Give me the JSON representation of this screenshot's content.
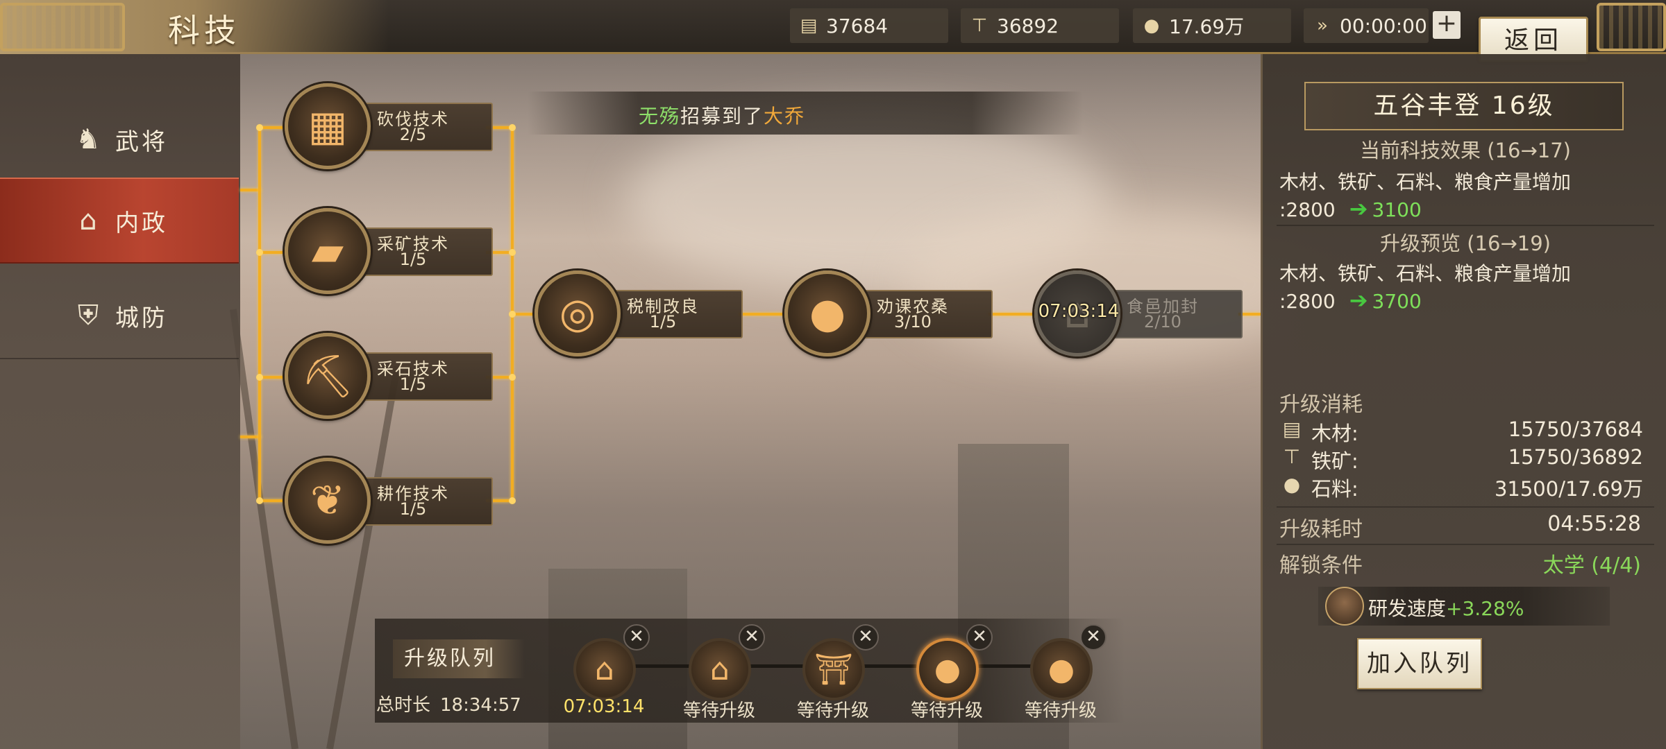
{
  "header": {
    "title": "科技",
    "back_label": "返回",
    "plus_label": "+",
    "resources": [
      {
        "icon": "wood-icon",
        "value": "37684"
      },
      {
        "icon": "iron-icon",
        "value": "36892"
      },
      {
        "icon": "stone-icon",
        "value": "17.69万"
      },
      {
        "icon": "speedup-icon",
        "value": "00:00:00"
      }
    ]
  },
  "sidebar": {
    "items": [
      {
        "label": "武将",
        "icon": "general-icon",
        "active": false
      },
      {
        "label": "内政",
        "icon": "domestic-icon",
        "active": true
      },
      {
        "label": "城防",
        "icon": "defense-icon",
        "active": false
      }
    ]
  },
  "banner": {
    "hero": "无殇",
    "text": "招募到了",
    "target": "大乔"
  },
  "tree": {
    "nodes": [
      {
        "name": "砍伐技术",
        "level": "2/5",
        "icon": "logs-icon"
      },
      {
        "name": "采矿技术",
        "level": "1/5",
        "icon": "ingot-icon"
      },
      {
        "name": "采石技术",
        "level": "1/5",
        "icon": "pickaxe-icon"
      },
      {
        "name": "耕作技术",
        "level": "1/5",
        "icon": "wheat-icon"
      },
      {
        "name": "税制改良",
        "level": "1/5",
        "icon": "coins-icon"
      },
      {
        "name": "劝课农桑",
        "level": "3/10",
        "icon": "grain-sack-icon"
      },
      {
        "name": "食邑加封",
        "level": "2/10",
        "icon": "house-icon",
        "timer": "07:03:14"
      }
    ]
  },
  "detail": {
    "title": "五谷丰登 16级",
    "current_title": "当前科技效果 (16→17)",
    "current_text": "木材、铁矿、石料、粮食产量增加",
    "current_from": ":2800",
    "current_to": "3100",
    "preview_title": "升级预览 (16→19)",
    "preview_text": "木材、铁矿、石料、粮食产量增加",
    "preview_from": ":2800",
    "preview_to": "3700",
    "cost_label": "升级消耗",
    "costs": [
      {
        "icon": "wood-icon",
        "label": "木材:",
        "value": "15750/37684"
      },
      {
        "icon": "iron-icon",
        "label": "铁矿:",
        "value": "15750/36892"
      },
      {
        "icon": "stone-icon",
        "label": "石料:",
        "value": "31500/17.69万"
      }
    ],
    "time_label": "升级耗时",
    "time_value": "04:55:28",
    "unlock_label": "解锁条件",
    "unlock_value": "太学 (4/4)",
    "speed_label": "研发速度",
    "speed_value": "+3.28%",
    "add_queue_label": "加入队列"
  },
  "queue": {
    "title": "升级队列",
    "total_label": "总时长",
    "total_value": "18:34:57",
    "slots": [
      {
        "label": "07:03:14",
        "icon": "house-icon",
        "current": false
      },
      {
        "label": "等待升级",
        "icon": "house-up-icon",
        "current": false
      },
      {
        "label": "等待升级",
        "icon": "city-gate-icon",
        "current": false
      },
      {
        "label": "等待升级",
        "icon": "grain-sack-icon",
        "current": true
      },
      {
        "label": "等待升级",
        "icon": "grain-sack-icon",
        "current": false
      }
    ],
    "close_symbol": "✕"
  }
}
